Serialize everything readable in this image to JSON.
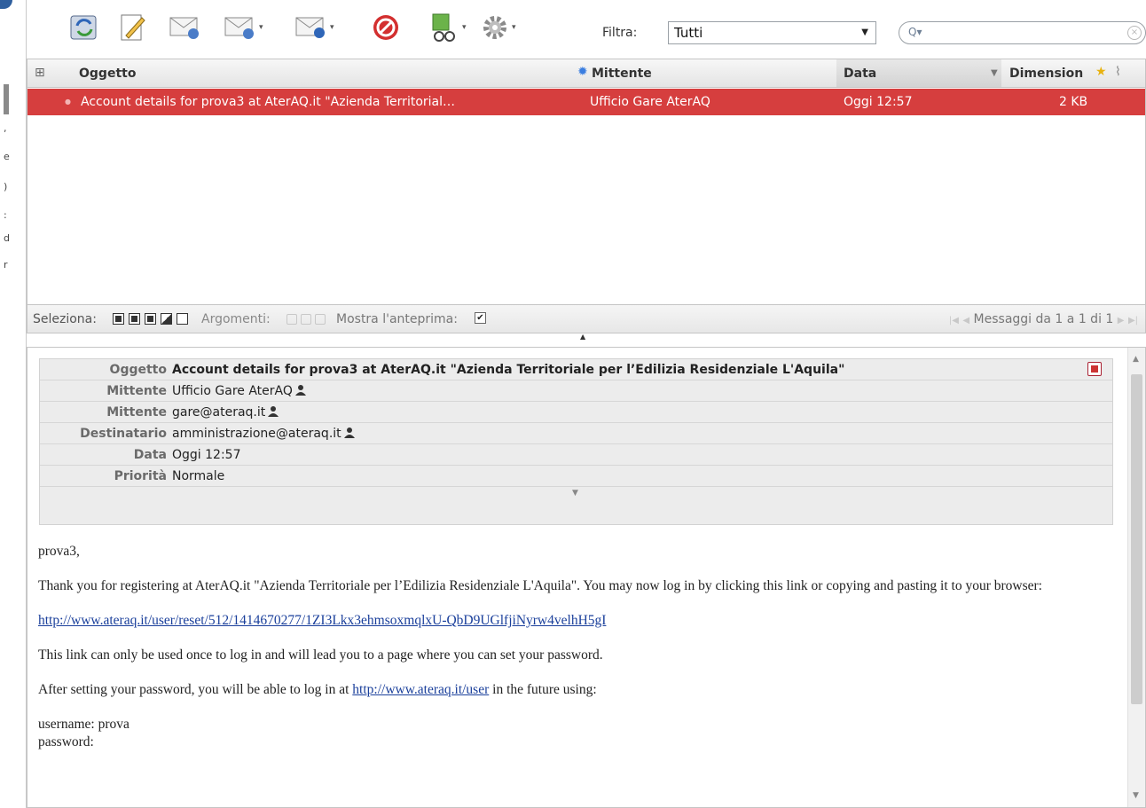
{
  "toolbar": {
    "icons": [
      "refresh-icon",
      "compose-icon",
      "reply-icon",
      "reply-all-icon",
      "forward-icon",
      "delete-icon",
      "mark-icon",
      "settings-icon"
    ],
    "filter_label": "Filtra:",
    "filter_value": "Tutti",
    "search_placeholder": ""
  },
  "list": {
    "columns": {
      "subject": "Oggetto",
      "sender": "Mittente",
      "date": "Data",
      "size": "Dimension"
    },
    "selected_row": {
      "subject": "Account details for prova3 at AterAQ.it \"Azienda Territorial…",
      "sender": "Ufficio Gare AterAQ",
      "date": "Oggi 12:57",
      "size": "2 KB"
    },
    "footer": {
      "select_label": "Seleziona:",
      "threads_label": "Argomenti:",
      "preview_label": "Mostra l'anteprima:",
      "preview_checked": true,
      "pager": "Messaggi da 1 a 1 di 1"
    }
  },
  "preview": {
    "headers": [
      {
        "label": "Oggetto",
        "value": "Account details for prova3 at AterAQ.it \"Azienda Territoriale per l’Edilizia Residenziale L'Aquila\""
      },
      {
        "label": "Mittente",
        "value": "Ufficio Gare AterAQ"
      },
      {
        "label": "Mittente",
        "value": "gare@ateraq.it"
      },
      {
        "label": "Destinatario",
        "value": "amministrazione@ateraq.it"
      },
      {
        "label": "Data",
        "value": "Oggi 12:57"
      },
      {
        "label": "Priorità",
        "value": "Normale"
      }
    ],
    "body": {
      "greeting": "prova3,",
      "para1": "Thank you for registering at AterAQ.it \"Azienda Territoriale per l’Edilizia Residenziale L'Aquila\". You may now log in by clicking this link or copying and pasting it to your browser:",
      "reset_link": "http://www.ateraq.it/user/reset/512/1414670277/1ZI3Lkx3ehmsoxmqlxU-QbD9UGlfjiNyrw4velhH5gI",
      "para2": "This link can only be used once to log in and will lead you to a page where you can set your password.",
      "para3_before": "After setting your password, you will be able to log in at",
      "user_link": "http://www.ateraq.it/user",
      "para3_after": "in the future using:",
      "username_line": "username: prova",
      "password_line": "password:"
    }
  },
  "left_strip_chars": [
    ",",
    "e",
    ")",
    ":",
    "d",
    "r"
  ]
}
